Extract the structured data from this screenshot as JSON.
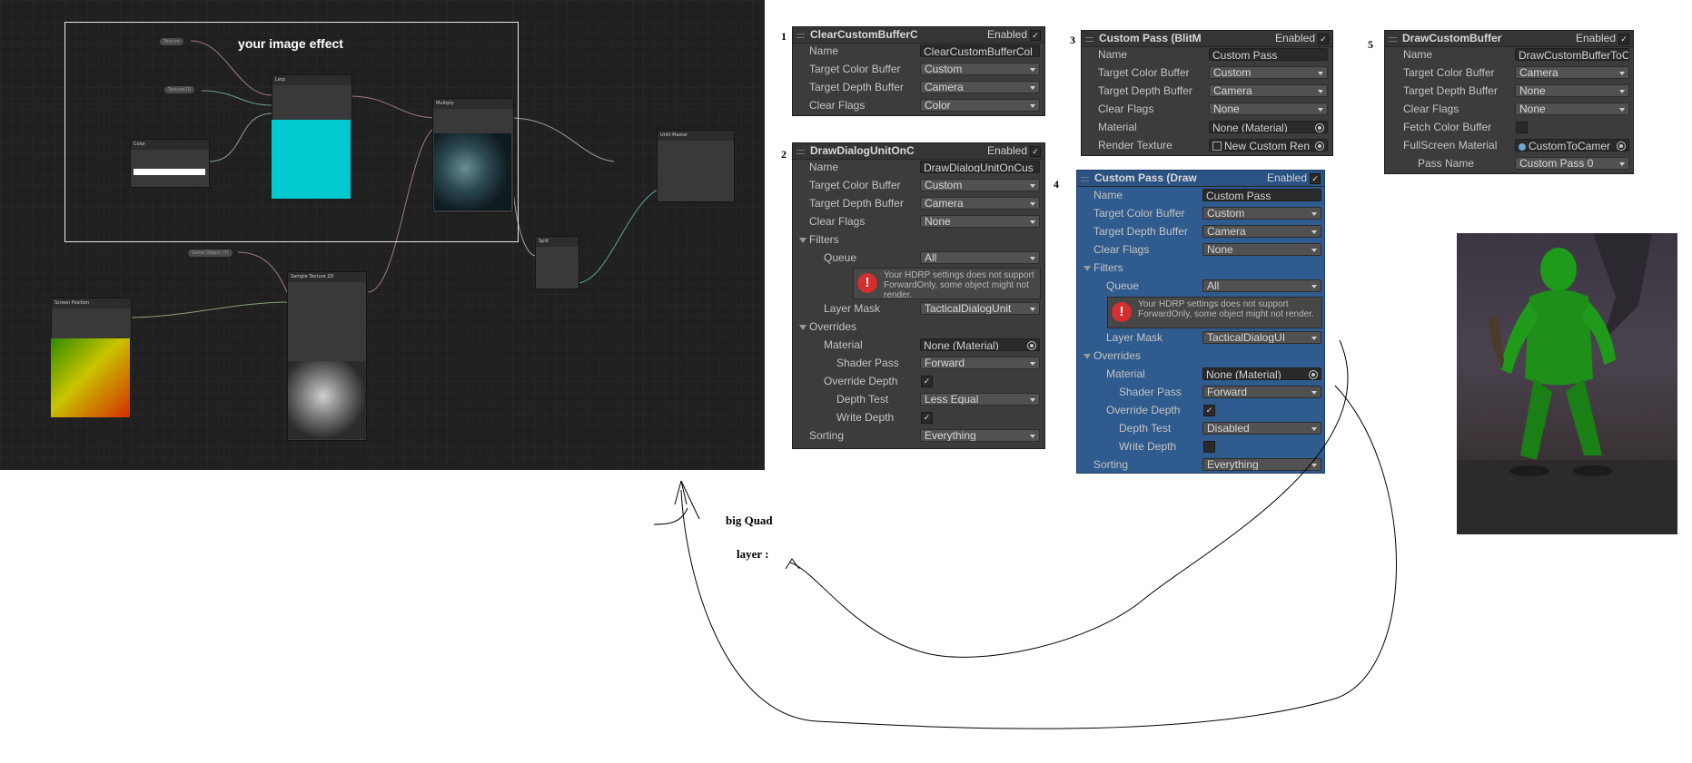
{
  "graph": {
    "effect_label": "your image effect",
    "nodes": {
      "lerp": "Lerp",
      "multiply": "Multiply",
      "unlit_master": "Unlit Master",
      "color": "Color",
      "split": "Split",
      "screen_position": "Screen Position",
      "sample_texture": "Sample Texture 2D"
    },
    "pills": {
      "pill_a": "Texture",
      "pill_b": "Texture2D",
      "pill_c": "Some Object (T)"
    }
  },
  "inspectors": [
    {
      "number": "1",
      "title": "ClearCustomBufferC",
      "enabled_label": "Enabled",
      "rows": {
        "name": {
          "label": "Name",
          "value": "ClearCustomBufferCol"
        },
        "target_color": {
          "label": "Target Color Buffer",
          "value": "Custom"
        },
        "target_depth": {
          "label": "Target Depth Buffer",
          "value": "Camera"
        },
        "clear_flags": {
          "label": "Clear Flags",
          "value": "Color"
        }
      }
    },
    {
      "number": "2",
      "title": "DrawDialogUnitOnC",
      "enabled_label": "Enabled",
      "rows": {
        "name": {
          "label": "Name",
          "value": "DrawDialogUnitOnCus"
        },
        "target_color": {
          "label": "Target Color Buffer",
          "value": "Custom"
        },
        "target_depth": {
          "label": "Target Depth Buffer",
          "value": "Camera"
        },
        "clear_flags": {
          "label": "Clear Flags",
          "value": "None"
        },
        "filters": {
          "label": "Filters"
        },
        "queue": {
          "label": "Queue",
          "value": "All"
        },
        "warning": "Your HDRP settings does not support ForwardOnly, some object might not render.",
        "layer_mask": {
          "label": "Layer Mask",
          "value": "TacticalDialogUnit"
        },
        "overrides": {
          "label": "Overrides"
        },
        "material": {
          "label": "Material",
          "value": "None (Material)"
        },
        "shader_pass": {
          "label": "Shader Pass",
          "value": "Forward"
        },
        "override_depth": {
          "label": "Override Depth"
        },
        "depth_test": {
          "label": "Depth Test",
          "value": "Less Equal"
        },
        "write_depth": {
          "label": "Write Depth"
        },
        "sorting": {
          "label": "Sorting",
          "value": "Everything"
        }
      }
    },
    {
      "number": "3",
      "title": "Custom Pass (BlitM",
      "enabled_label": "Enabled",
      "rows": {
        "name": {
          "label": "Name",
          "value": "Custom Pass"
        },
        "target_color": {
          "label": "Target Color Buffer",
          "value": "Custom"
        },
        "target_depth": {
          "label": "Target Depth Buffer",
          "value": "Camera"
        },
        "clear_flags": {
          "label": "Clear Flags",
          "value": "None"
        },
        "material": {
          "label": "Material",
          "value": "None (Material)"
        },
        "render_texture": {
          "label": "Render Texture",
          "value": "New Custom Ren"
        }
      }
    },
    {
      "number": "4",
      "title": "Custom Pass (Draw",
      "enabled_label": "Enabled",
      "rows": {
        "name": {
          "label": "Name",
          "value": "Custom Pass"
        },
        "target_color": {
          "label": "Target Color Buffer",
          "value": "Custom"
        },
        "target_depth": {
          "label": "Target Depth Buffer",
          "value": "Camera"
        },
        "clear_flags": {
          "label": "Clear Flags",
          "value": "None"
        },
        "filters": {
          "label": "Filters"
        },
        "queue": {
          "label": "Queue",
          "value": "All"
        },
        "warning": "Your HDRP settings does not support ForwardOnly, some object might not render.",
        "layer_mask": {
          "label": "Layer Mask",
          "value": "TacticalDialogUI"
        },
        "overrides": {
          "label": "Overrides"
        },
        "material": {
          "label": "Material",
          "value": "None (Material)"
        },
        "shader_pass": {
          "label": "Shader Pass",
          "value": "Forward"
        },
        "override_depth": {
          "label": "Override Depth"
        },
        "depth_test": {
          "label": "Depth Test",
          "value": "Disabled"
        },
        "write_depth": {
          "label": "Write Depth"
        },
        "sorting": {
          "label": "Sorting",
          "value": "Everything"
        }
      }
    },
    {
      "number": "5",
      "title": "DrawCustomBufferT",
      "enabled_label": "Enabled",
      "rows": {
        "name": {
          "label": "Name",
          "value": "DrawCustomBufferToC"
        },
        "target_color": {
          "label": "Target Color Buffer",
          "value": "Camera"
        },
        "target_depth": {
          "label": "Target Depth Buffer",
          "value": "None"
        },
        "clear_flags": {
          "label": "Clear Flags",
          "value": "None"
        },
        "fetch_color": {
          "label": "Fetch Color Buffer"
        },
        "fullscreen_material": {
          "label": "FullScreen Material",
          "value": "CustomToCamer"
        },
        "pass_name": {
          "label": "Pass Name",
          "value": "Custom Pass 0"
        }
      }
    }
  ],
  "annotations": {
    "big_quad": "big Quad",
    "layer": "layer :"
  },
  "colors": {
    "graph_bg": "#202020",
    "inspector_bg": "#3c3c3c",
    "inspector_highlight": "#2f5b8e",
    "cyan_swatch": "#00c9cf",
    "warning_icon": "#d32f2f"
  }
}
